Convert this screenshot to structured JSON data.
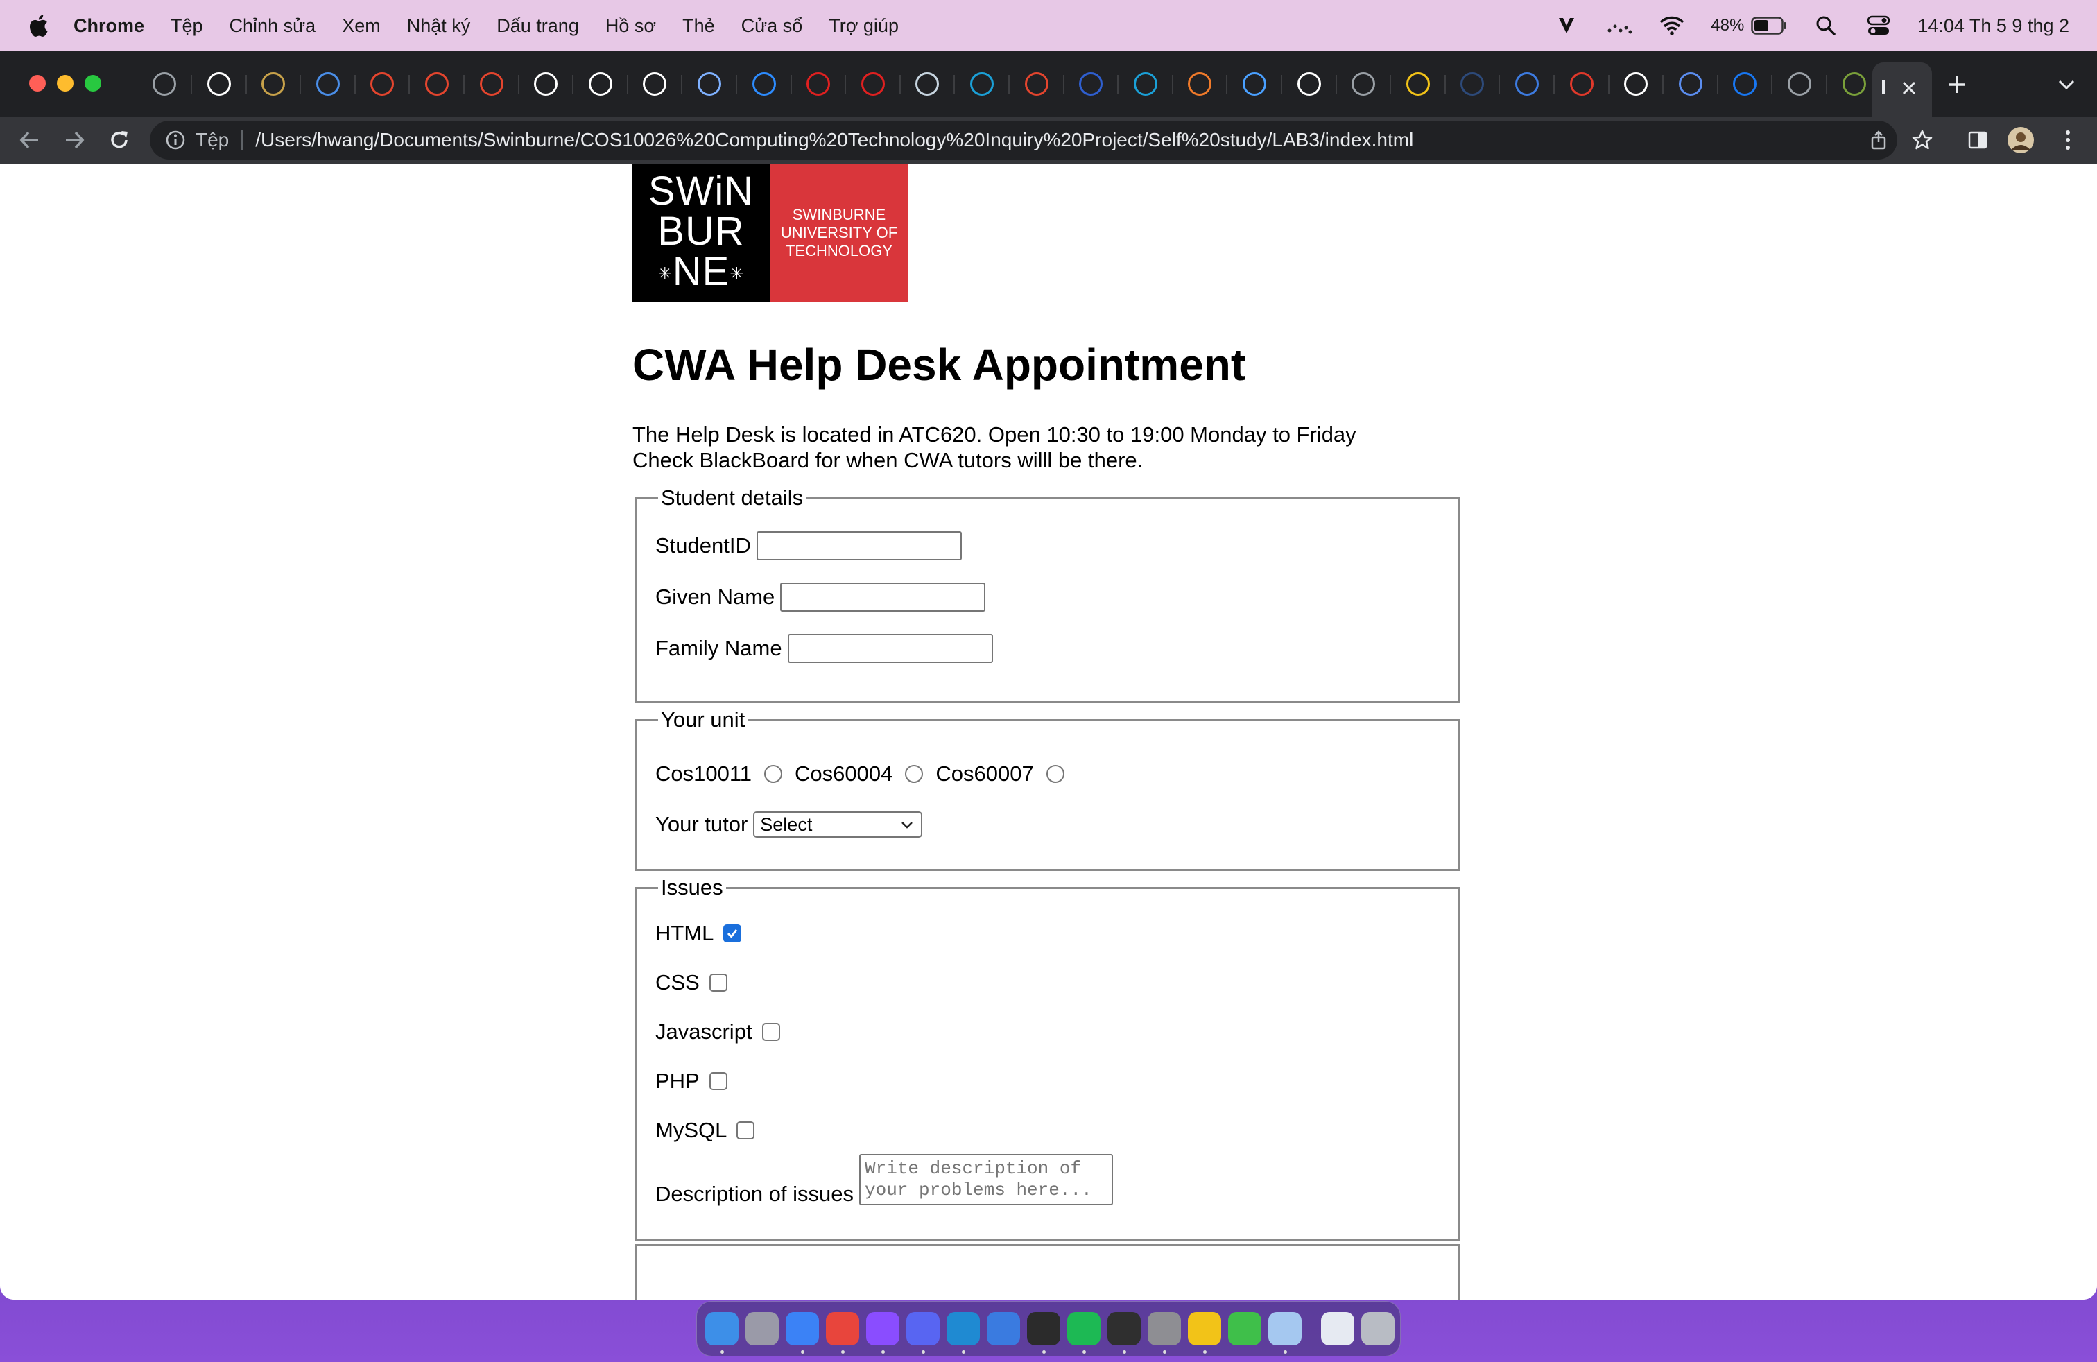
{
  "menubar": {
    "app_name": "Chrome",
    "items": [
      "Tệp",
      "Chỉnh sửa",
      "Xem",
      "Nhật ký",
      "Dấu trang",
      "Hồ sơ",
      "Thẻ",
      "Cửa sổ",
      "Trợ giúp"
    ],
    "battery": "48%",
    "clock": "14:04 Th 5 9 thg 2",
    "status_icons": [
      "vivaldi-icon",
      "wifi-icon",
      "battery-icon",
      "spotlight-icon",
      "control-center-icon"
    ]
  },
  "browser": {
    "tabs": [
      {
        "icon": "globe-icon",
        "color": "#9aa0a6"
      },
      {
        "icon": "google-icon",
        "color": "#ffffff"
      },
      {
        "icon": "vivaldi-tab-icon",
        "color": "#c8a24a"
      },
      {
        "icon": "shield-icon",
        "color": "#4a8ee8"
      },
      {
        "icon": "canvas-icon",
        "color": "#e4452e"
      },
      {
        "icon": "canvas-icon",
        "color": "#e4452e"
      },
      {
        "icon": "canvas-icon",
        "color": "#e4452e"
      },
      {
        "icon": "google-icon",
        "color": "#ffffff"
      },
      {
        "icon": "google-icon",
        "color": "#ffffff"
      },
      {
        "icon": "google-icon",
        "color": "#ffffff"
      },
      {
        "icon": "q-icon",
        "color": "#7fb1ff"
      },
      {
        "icon": "plane-icon",
        "color": "#2d8cff"
      },
      {
        "icon": "alpha-icon",
        "color": "#e02020"
      },
      {
        "icon": "alpha-icon",
        "color": "#e02020"
      },
      {
        "icon": "steam-icon",
        "color": "#c7d5e0"
      },
      {
        "icon": "cisco-icon",
        "color": "#1ba0d7"
      },
      {
        "icon": "canvas-icon",
        "color": "#e4452e"
      },
      {
        "icon": "m-icon",
        "color": "#2f5fd0"
      },
      {
        "icon": "cisco-icon",
        "color": "#1ba0d7"
      },
      {
        "icon": "puzzle-icon",
        "color": "#f07a2a"
      },
      {
        "icon": "brackets-icon",
        "color": "#4aa0ff"
      },
      {
        "icon": "google-icon",
        "color": "#ffffff"
      },
      {
        "icon": "globe-icon",
        "color": "#9aa0a6"
      },
      {
        "icon": "triangle-icon",
        "color": "#f2c318"
      },
      {
        "icon": "tds-icon",
        "color": "#2d4a7a"
      },
      {
        "icon": "box-icon",
        "color": "#3d7be0"
      },
      {
        "icon": "c-icon",
        "color": "#e0392b"
      },
      {
        "icon": "chrome-icon",
        "color": "#ffffff"
      },
      {
        "icon": "window-icon",
        "color": "#5b8def"
      },
      {
        "icon": "facebook-icon",
        "color": "#1877f2"
      },
      {
        "icon": "globe-icon",
        "color": "#9aa0a6"
      },
      {
        "icon": "pawn-icon",
        "color": "#7aa03a"
      },
      {
        "icon": "pawn-icon",
        "color": "#7aa03a"
      }
    ],
    "address_label": "Tệp",
    "url": "/Users/hwang/Documents/Swinburne/COS10026%20Computing%20Technology%20Inquiry%20Project/Self%20study/LAB3/index.html"
  },
  "page": {
    "logo": {
      "lines": [
        "SWiN",
        "BUR",
        "NE"
      ],
      "tagline": [
        "SWINBURNE",
        "UNIVERSITY OF",
        "TECHNOLOGY"
      ]
    },
    "title": "CWA Help Desk Appointment",
    "intro_line1": "The Help Desk is located in ATC620. Open 10:30 to 19:00 Monday to Friday",
    "intro_line2": "Check BlackBoard for when CWA tutors willl be there.",
    "student": {
      "legend": "Student details",
      "student_id_label": "StudentID",
      "student_id_value": "",
      "given_name_label": "Given Name",
      "given_name_value": "",
      "family_name_label": "Family Name",
      "family_name_value": ""
    },
    "unit": {
      "legend": "Your unit",
      "options": [
        "Cos10011",
        "Cos60004",
        "Cos60007"
      ],
      "selected": null,
      "tutor_label": "Your tutor",
      "tutor_select": "Select"
    },
    "issues": {
      "legend": "Issues",
      "items": [
        {
          "label": "HTML",
          "checked": true
        },
        {
          "label": "CSS",
          "checked": false
        },
        {
          "label": "Javascript",
          "checked": false
        },
        {
          "label": "PHP",
          "checked": false
        },
        {
          "label": "MySQL",
          "checked": false
        }
      ],
      "description_label": "Description of issues",
      "description_placeholder": "Write description of your problems here..."
    }
  },
  "dock": {
    "apps": [
      {
        "icon": "finder-icon",
        "color": "#3d8fe8",
        "running": true
      },
      {
        "icon": "launchpad-icon",
        "color": "#9a9aa8",
        "running": false
      },
      {
        "icon": "safari-icon",
        "color": "#3b82f6",
        "running": true
      },
      {
        "icon": "chrome-icon",
        "color": "#e8453c",
        "running": true
      },
      {
        "icon": "messenger-icon",
        "color": "#8a4dff",
        "running": true
      },
      {
        "icon": "discord-icon",
        "color": "#5865f2",
        "running": true
      },
      {
        "icon": "vscode-icon",
        "color": "#1f8ad2",
        "running": true
      },
      {
        "icon": "xcode-icon",
        "color": "#3a7be0",
        "running": false
      },
      {
        "icon": "terminal-icon",
        "color": "#2b2b2b",
        "running": true
      },
      {
        "icon": "spotify-icon",
        "color": "#1db954",
        "running": true
      },
      {
        "icon": "activity-monitor-icon",
        "color": "#2f2f2f",
        "running": true
      },
      {
        "icon": "settings-icon",
        "color": "#8e8e93",
        "running": true
      },
      {
        "icon": "vivaldi-dock-icon",
        "color": "#f2c318",
        "running": true
      },
      {
        "icon": "numbers-icon",
        "color": "#3fbf4a",
        "running": false
      },
      {
        "icon": "preview-icon",
        "color": "#a5c8f0",
        "running": true
      },
      {
        "icon": "documents-icon",
        "color": "#e6eaf2",
        "running": false
      },
      {
        "icon": "trash-icon",
        "color": "#b8bcc4",
        "running": false
      }
    ]
  }
}
